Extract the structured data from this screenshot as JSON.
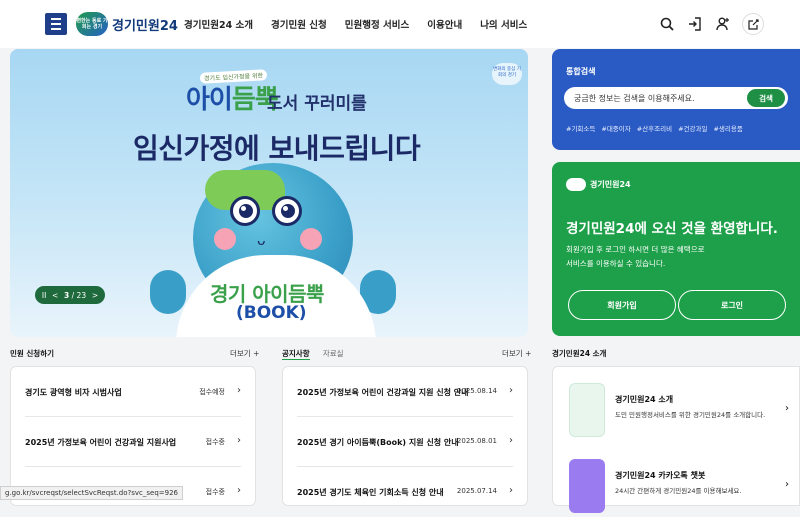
{
  "header": {
    "logo_badge": "편한는 동로 기회는 경기",
    "logo_text": "경기민원24",
    "nav": [
      "경기민원24 소개",
      "경기민원 신청",
      "민원행정 서비스",
      "이용안내",
      "나의 서비스"
    ]
  },
  "banner": {
    "small_tag": "경기도 임신가정을 위한",
    "brand_a": "아이",
    "brand_b": "듬뿍",
    "sub": "도서 꾸러미를",
    "title": "임신가정에 보내드립니다",
    "book_title": "경기 아이듬뿍",
    "book_sub": "(BOOK)",
    "badge": "변화의 중심 기회의 경기",
    "pager": {
      "pause": "II",
      "prev": "<",
      "current": "3",
      "total": "23",
      "next": ">"
    }
  },
  "search": {
    "label": "통합검색",
    "placeholder": "궁금한 정보는 검색을 이용해주세요.",
    "button": "검색",
    "tags": [
      "#기회소득",
      "#대중이자",
      "#산후조리비",
      "#건강과일",
      "#생리용품"
    ]
  },
  "welcome": {
    "logo": "경기민원24",
    "title": "경기민원24에 오신 것을 환영합니다.",
    "desc1": "회원가입 후 로그인 하시면 더 많은 혜택으로",
    "desc2": "서비스를 이용하실 수 있습니다.",
    "signup": "회원가입",
    "login": "로그인"
  },
  "apply": {
    "title": "민원 신청하기",
    "more": "더보기 +",
    "items": [
      {
        "title": "경기도 광역형 비자 시범사업",
        "status": "접수예정"
      },
      {
        "title": "2025년 가정보육 어린이 건강과일 지원사업",
        "status": "접수중"
      },
      {
        "title": "",
        "status": "접수중"
      }
    ]
  },
  "notice": {
    "tab_active": "공지사항",
    "tab_inactive": "자료실",
    "more": "더보기 +",
    "items": [
      {
        "title": "2025년 가정보육 어린이 건강과일 지원 신청 안내",
        "date": "2025.08.14"
      },
      {
        "title": "2025년 경기 아이듬뿍(Book) 지원 신청 안내",
        "date": "2025.08.01"
      },
      {
        "title": "2025년 경기도 체육인 기회소득 신청 안내",
        "date": "2025.07.14"
      }
    ]
  },
  "intro": {
    "title": "경기민원24 소개",
    "items": [
      {
        "title": "경기민원24 소개",
        "desc": "도민 민원행정서비스를 위한 경기민원24를 소개합니다.",
        "icon_color": "#e8f6ee"
      },
      {
        "title": "경기민원24 카카오톡 챗봇",
        "desc": "24시간 간편하게 경기민원24를 이용해보세요.",
        "icon_color": "#9b7cf0"
      }
    ]
  },
  "status_url": "g.go.kr/svcreqst/selectSvcReqst.do?svc_seq=926"
}
